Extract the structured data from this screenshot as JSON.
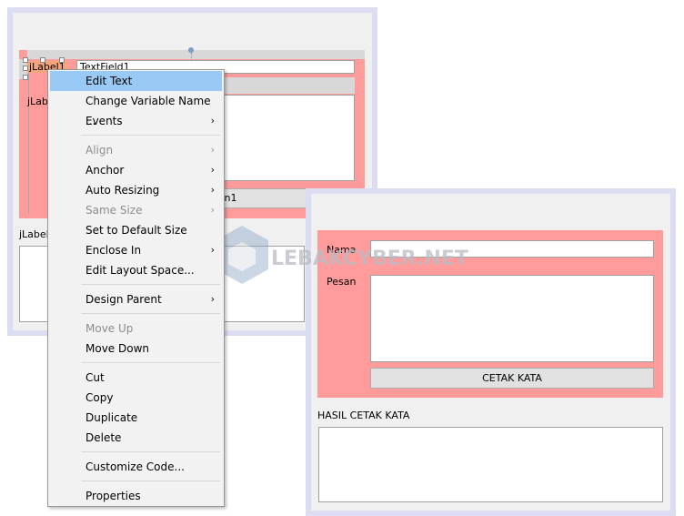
{
  "designer": {
    "label1": "jLabel1",
    "textfield1": "TextField1",
    "label2": "jLabel2",
    "button1": "jButton1",
    "label3": "jLabel3"
  },
  "context_menu": {
    "items": [
      {
        "label": "Edit Text",
        "highlighted": true
      },
      {
        "label": "Change Variable Name ..."
      },
      {
        "label": "Events",
        "submenu": true
      },
      {
        "separator": true
      },
      {
        "label": "Align",
        "submenu": true,
        "disabled": true
      },
      {
        "label": "Anchor",
        "submenu": true
      },
      {
        "label": "Auto Resizing",
        "submenu": true
      },
      {
        "label": "Same Size",
        "submenu": true,
        "disabled": true
      },
      {
        "label": "Set to Default Size"
      },
      {
        "label": "Enclose In",
        "submenu": true
      },
      {
        "label": "Edit Layout Space..."
      },
      {
        "separator": true
      },
      {
        "label": "Design Parent",
        "submenu": true
      },
      {
        "separator": true
      },
      {
        "label": "Move Up",
        "disabled": true
      },
      {
        "label": "Move Down"
      },
      {
        "separator": true
      },
      {
        "label": "Cut"
      },
      {
        "label": "Copy"
      },
      {
        "label": "Duplicate"
      },
      {
        "label": "Delete"
      },
      {
        "separator": true
      },
      {
        "label": "Customize Code..."
      },
      {
        "separator": true
      },
      {
        "label": "Properties"
      }
    ]
  },
  "preview": {
    "nama_label": "Nama",
    "pesan_label": "Pesan",
    "button": "CETAK KATA",
    "hasil_label": "HASIL CETAK KATA"
  },
  "watermark": "LEBAKCYBER.NET",
  "colors": {
    "panel": "#ff9b9b",
    "highlight": "#99c9f5",
    "window_border": "#dcdcf2"
  }
}
